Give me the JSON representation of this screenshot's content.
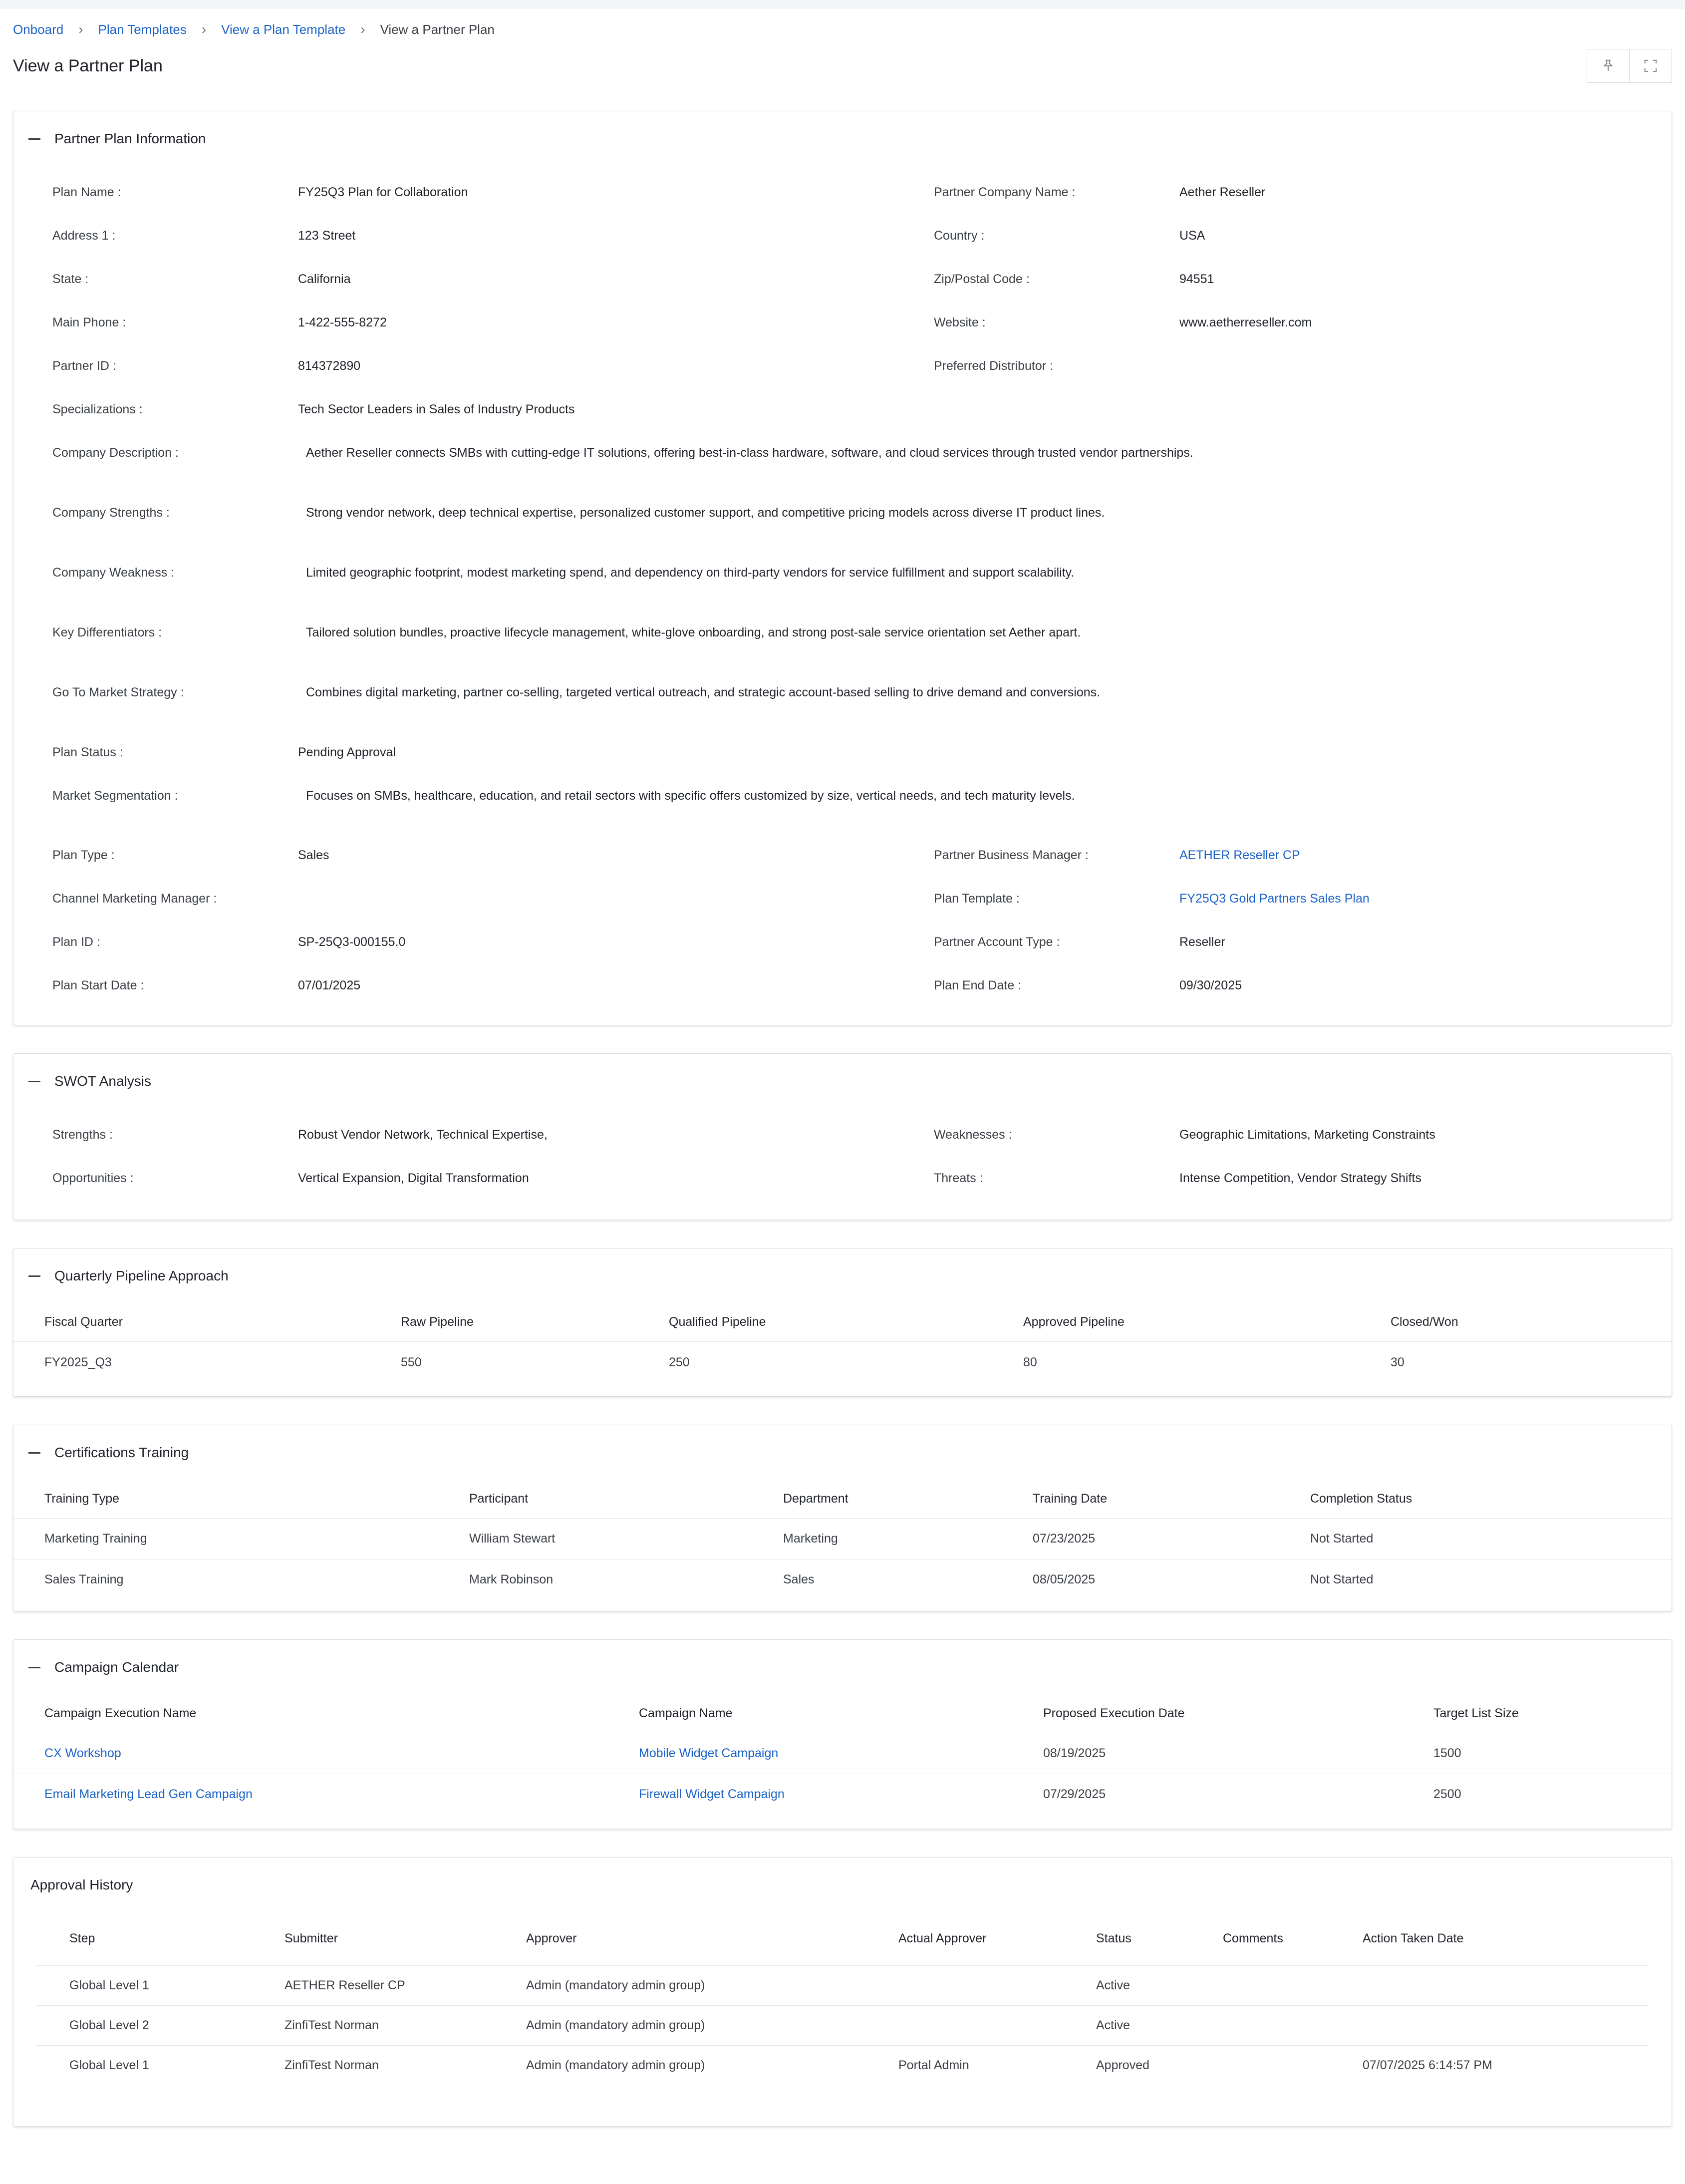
{
  "breadcrumb": {
    "items": [
      "Onboard",
      "Plan Templates",
      "View a Plan Template"
    ],
    "current": "View a Partner Plan"
  },
  "page": {
    "title": "View a Partner Plan",
    "actions": [
      {
        "icon": "pin-icon",
        "glyph": "✧"
      },
      {
        "icon": "fullscreen-icon",
        "glyph": "⛶"
      }
    ]
  },
  "plan_info": {
    "title": "Partner Plan Information",
    "plan_name": {
      "label": "Plan Name :",
      "value": "FY25Q3 Plan for Collaboration"
    },
    "partner_company_name": {
      "label": "Partner Company Name :",
      "value": "Aether Reseller"
    },
    "address1": {
      "label": "Address 1 :",
      "value": "123 Street"
    },
    "country": {
      "label": "Country :",
      "value": "USA"
    },
    "state": {
      "label": "State :",
      "value": "California"
    },
    "zip": {
      "label": "Zip/Postal Code :",
      "value": "94551"
    },
    "main_phone": {
      "label": "Main Phone :",
      "value": "1-422-555-8272"
    },
    "website": {
      "label": "Website :",
      "value": "www.aetherreseller.com"
    },
    "partner_id": {
      "label": "Partner ID :",
      "value": "814372890"
    },
    "preferred_distributor": {
      "label": "Preferred Distributor :",
      "value": ""
    },
    "specializations": {
      "label": "Specializations :",
      "value": "Tech Sector Leaders in Sales of Industry Products"
    },
    "company_description": {
      "label": "Company Description :",
      "value": "Aether Reseller connects SMBs with cutting-edge IT solutions, offering best-in-class hardware, software, and cloud services through trusted vendor partnerships."
    },
    "company_strengths": {
      "label": "Company Strengths :",
      "value": "Strong vendor network, deep technical expertise, personalized customer support, and competitive pricing models across diverse IT product lines."
    },
    "company_weakness": {
      "label": "Company Weakness :",
      "value": "Limited geographic footprint, modest marketing spend, and dependency on third-party vendors for service fulfillment and support scalability."
    },
    "key_differentiators": {
      "label": "Key Differentiators :",
      "value": "Tailored solution bundles, proactive lifecycle management, white-glove onboarding, and strong post-sale service orientation set Aether apart."
    },
    "gtm_strategy": {
      "label": "Go To Market Strategy :",
      "value": "Combines digital marketing, partner co-selling, targeted vertical outreach, and strategic account-based selling to drive demand and conversions."
    },
    "plan_status": {
      "label": "Plan Status :",
      "value": "Pending Approval"
    },
    "market_segmentation": {
      "label": "Market Segmentation :",
      "value": "Focuses on SMBs, healthcare, education, and retail sectors with specific offers customized by size, vertical needs, and tech maturity levels."
    },
    "plan_type": {
      "label": "Plan Type :",
      "value": "Sales"
    },
    "partner_business_manager": {
      "label": "Partner Business Manager :",
      "value": "AETHER Reseller CP"
    },
    "channel_marketing_manager": {
      "label": "Channel Marketing Manager :",
      "value": ""
    },
    "plan_template": {
      "label": "Plan Template :",
      "value": "FY25Q3 Gold Partners Sales Plan"
    },
    "plan_id": {
      "label": "Plan ID :",
      "value": "SP-25Q3-000155.0"
    },
    "partner_account_type": {
      "label": "Partner Account Type :",
      "value": "Reseller"
    },
    "plan_start_date": {
      "label": "Plan Start Date :",
      "value": "07/01/2025"
    },
    "plan_end_date": {
      "label": "Plan End Date :",
      "value": "09/30/2025"
    }
  },
  "swot": {
    "title": "SWOT Analysis",
    "strengths": {
      "label": "Strengths :",
      "value": "Robust Vendor Network, Technical Expertise,"
    },
    "weaknesses": {
      "label": "Weaknesses :",
      "value": "Geographic Limitations, Marketing Constraints"
    },
    "opportunities": {
      "label": "Opportunities :",
      "value": "Vertical Expansion, Digital Transformation"
    },
    "threats": {
      "label": "Threats :",
      "value": "Intense Competition, Vendor Strategy Shifts"
    }
  },
  "pipeline": {
    "title": "Quarterly Pipeline Approach",
    "columns": [
      "Fiscal Quarter",
      "Raw Pipeline",
      "Qualified Pipeline",
      "Approved Pipeline",
      "Closed/Won"
    ],
    "rows": [
      [
        "FY2025_Q3",
        "550",
        "250",
        "80",
        "30"
      ]
    ]
  },
  "certifications": {
    "title": "Certifications Training",
    "columns": [
      "Training Type",
      "Participant",
      "Department",
      "Training Date",
      "Completion Status"
    ],
    "rows": [
      [
        "Marketing Training",
        "William Stewart",
        "Marketing",
        "07/23/2025",
        "Not Started"
      ],
      [
        "Sales Training",
        "Mark Robinson",
        "Sales",
        "08/05/2025",
        "Not Started"
      ]
    ]
  },
  "campaigns": {
    "title": "Campaign Calendar",
    "columns": [
      "Campaign Execution Name",
      "Campaign Name",
      "Proposed Execution Date",
      "Target List Size"
    ],
    "rows": [
      [
        "CX Workshop",
        "Mobile Widget Campaign",
        "08/19/2025",
        "1500"
      ],
      [
        "Email Marketing Lead Gen Campaign",
        "Firewall Widget Campaign",
        "07/29/2025",
        "2500"
      ]
    ]
  },
  "approval": {
    "title": "Approval History",
    "columns": [
      "Step",
      "Submitter",
      "Approver",
      "Actual Approver",
      "Status",
      "Comments",
      "Action Taken Date"
    ],
    "rows": [
      [
        "Global Level 1",
        "AETHER Reseller CP",
        "Admin (mandatory admin group)",
        "",
        "Active",
        "",
        ""
      ],
      [
        "Global Level 2",
        "ZinfiTest Norman",
        "Admin (mandatory admin group)",
        "",
        "Active",
        "",
        ""
      ],
      [
        "Global Level 1",
        "ZinfiTest Norman",
        "Admin (mandatory admin group)",
        "Portal Admin",
        "Approved",
        "",
        "07/07/2025 6:14:57 PM"
      ]
    ]
  }
}
